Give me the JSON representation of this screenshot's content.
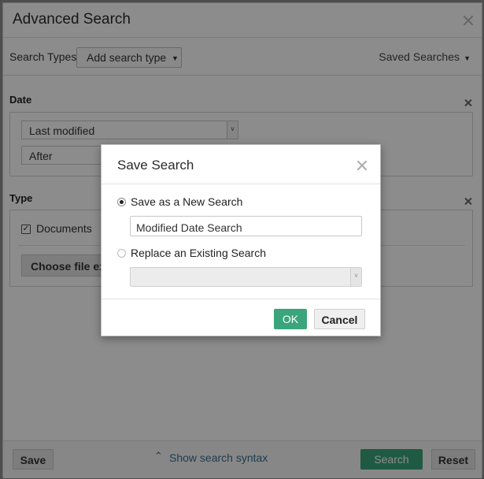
{
  "panel": {
    "title": "Advanced Search",
    "search_types_label": "Search Types",
    "add_search_type": "Add search type",
    "saved_searches": "Saved Searches",
    "date_section": {
      "title": "Date",
      "field_1": "Last modified",
      "field_2": "After"
    },
    "type_section": {
      "title": "Type",
      "documents_label": "Documents",
      "choose_button": "Choose file ext"
    },
    "footer": {
      "save_label": "Save",
      "show_syntax": "Show search syntax",
      "search_label": "Search",
      "reset_label": "Reset"
    }
  },
  "modal": {
    "title": "Save Search",
    "option_new": "Save as a New Search",
    "new_search_value": "Modified Date Search",
    "option_replace": "Replace an Existing Search",
    "ok_label": "OK",
    "cancel_label": "Cancel"
  },
  "colors": {
    "accent": "#3aa57c",
    "link": "#3a6d8f"
  }
}
